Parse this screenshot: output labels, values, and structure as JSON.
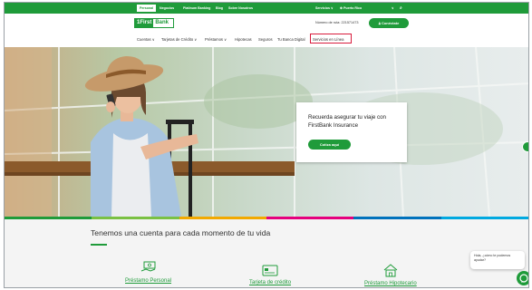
{
  "topbar": {
    "segments": [
      "Personal",
      "Negocios",
      "Platinum Banking",
      "Blog",
      "Sobre Nosotros"
    ],
    "right": {
      "services": "Servicios ∨",
      "region": "Puerto Rico",
      "region_chevron": "∨"
    }
  },
  "header": {
    "logo_part1": "1First",
    "logo_part2": "Bank",
    "routing_label": "Número de ruta: 221571473",
    "connect_label": "Conéctate"
  },
  "nav": {
    "items": [
      "Cuentas ∨",
      "Tarjetas de Crédito ∨",
      "Préstamos ∨",
      "Hipotecas",
      "Seguros",
      "Tu Banca Digital",
      "Servicios en Línea"
    ]
  },
  "hero": {
    "card_title": "Recuerda asegurar tu viaje con FirstBank Insurance",
    "card_cta": "Cotiza aquí"
  },
  "colors": {
    "brand_green": "#1f9b3a",
    "highlight_red": "#d81b3c",
    "strip": [
      "#1f9b3a",
      "#7ac143",
      "#f2a900",
      "#e5007d",
      "#0072bc",
      "#00a9e0"
    ]
  },
  "lower": {
    "heading": "Tenemos una cuenta para cada momento de tu vida",
    "products": [
      {
        "label": "Préstamo Personal",
        "icon": "cash-hand-icon"
      },
      {
        "label": "Tarjeta de crédito",
        "icon": "credit-card-icon"
      },
      {
        "label": "Préstamo Hipotecario",
        "icon": "house-icon"
      }
    ]
  },
  "chat": {
    "bubble_text": "Hola, ¿cómo te podemos ayudar?",
    "close_label": "–"
  }
}
